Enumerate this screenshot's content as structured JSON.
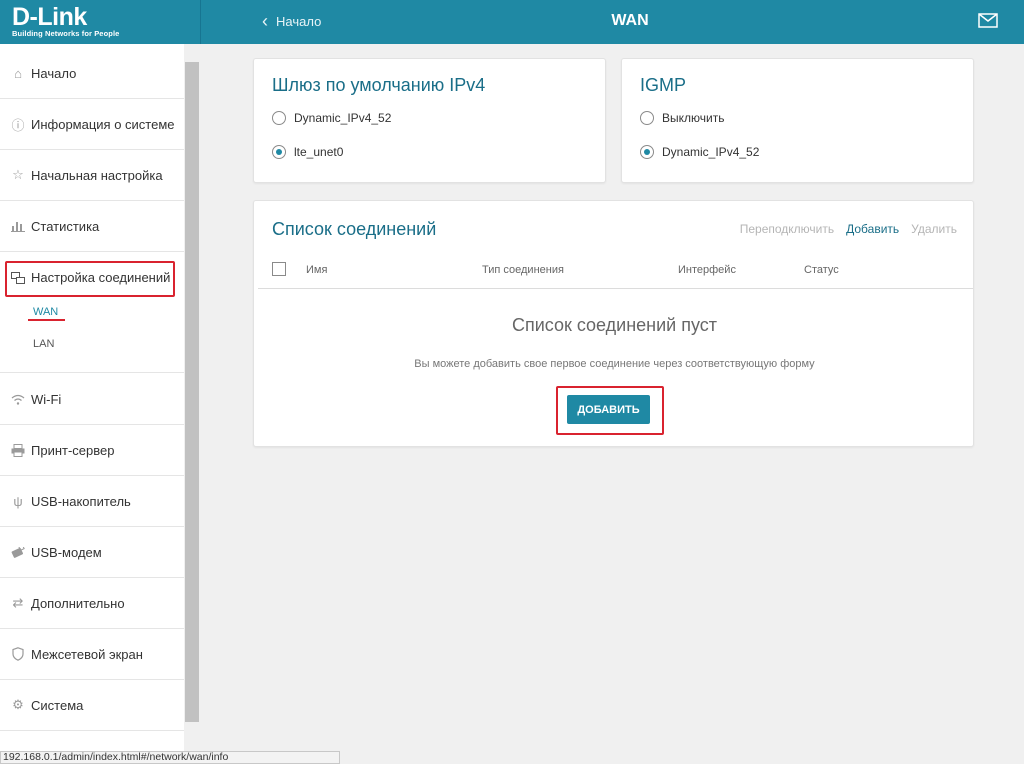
{
  "header": {
    "logo_main": "D-Link",
    "logo_tagline": "Building Networks for People",
    "back_label": "Начало",
    "title": "WAN",
    "accent": "#1f89a4"
  },
  "sidebar": {
    "items": [
      {
        "label": "Начало",
        "icon": "home-icon"
      },
      {
        "label": "Информация о системе",
        "icon": "info-icon"
      },
      {
        "label": "Начальная настройка",
        "icon": "star-icon"
      },
      {
        "label": "Статистика",
        "icon": "stats-icon"
      },
      {
        "label": "Настройка соединений",
        "icon": "connections-icon"
      },
      {
        "label": "Wi-Fi",
        "icon": "wifi-icon"
      },
      {
        "label": "Принт-сервер",
        "icon": "printer-icon"
      },
      {
        "label": "USB-накопитель",
        "icon": "usb-icon"
      },
      {
        "label": "USB-модем",
        "icon": "usb-modem-icon"
      },
      {
        "label": "Дополнительно",
        "icon": "arrows-icon"
      },
      {
        "label": "Межсетевой экран",
        "icon": "shield-icon"
      },
      {
        "label": "Система",
        "icon": "gear-icon"
      }
    ],
    "sub_items": [
      {
        "label": "WAN",
        "active": true
      },
      {
        "label": "LAN",
        "active": false
      }
    ]
  },
  "gateway": {
    "title": "Шлюз по умолчанию IPv4",
    "options": [
      {
        "label": "Dynamic_IPv4_52",
        "checked": false
      },
      {
        "label": "lte_unet0",
        "checked": true
      }
    ]
  },
  "igmp": {
    "title": "IGMP",
    "options": [
      {
        "label": "Выключить",
        "checked": false
      },
      {
        "label": "Dynamic_IPv4_52",
        "checked": true
      }
    ]
  },
  "connections": {
    "title": "Список соединений",
    "actions": {
      "reconnect": "Переподключить",
      "add": "Добавить",
      "delete": "Удалить"
    },
    "columns": [
      "Имя",
      "Тип соединения",
      "Интерфейс",
      "Статус"
    ],
    "empty_title": "Список соединений пуст",
    "empty_text": "Вы можете добавить свое первое соединение через соответствующую форму",
    "add_button": "ДОБАВИТЬ"
  },
  "status_bar": "192.168.0.1/admin/index.html#/network/wan/info"
}
